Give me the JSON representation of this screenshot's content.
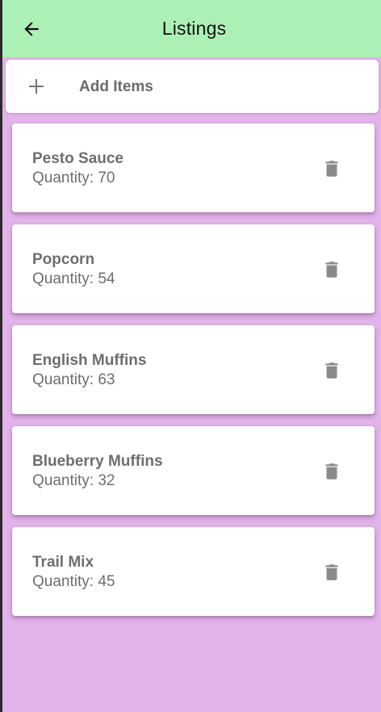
{
  "appbar": {
    "title": "Listings",
    "back_icon": "arrow-back-icon"
  },
  "add": {
    "label": "Add Items",
    "icon": "plus-icon"
  },
  "items": [
    {
      "name": "Pesto Sauce",
      "quantity_text": "Quantity: 70"
    },
    {
      "name": "Popcorn",
      "quantity_text": "Quantity: 54"
    },
    {
      "name": "English Muffins",
      "quantity_text": "Quantity: 63"
    },
    {
      "name": "Blueberry Muffins",
      "quantity_text": "Quantity: 32"
    },
    {
      "name": "Trail Mix",
      "quantity_text": "Quantity: 45"
    }
  ],
  "colors": {
    "appbar": "#adf0b5",
    "background": "#e2b3ea",
    "card": "#ffffff",
    "text_muted": "#6e6e6e",
    "icon": "#8a8a8a"
  },
  "icons": {
    "delete": "trash-icon"
  }
}
